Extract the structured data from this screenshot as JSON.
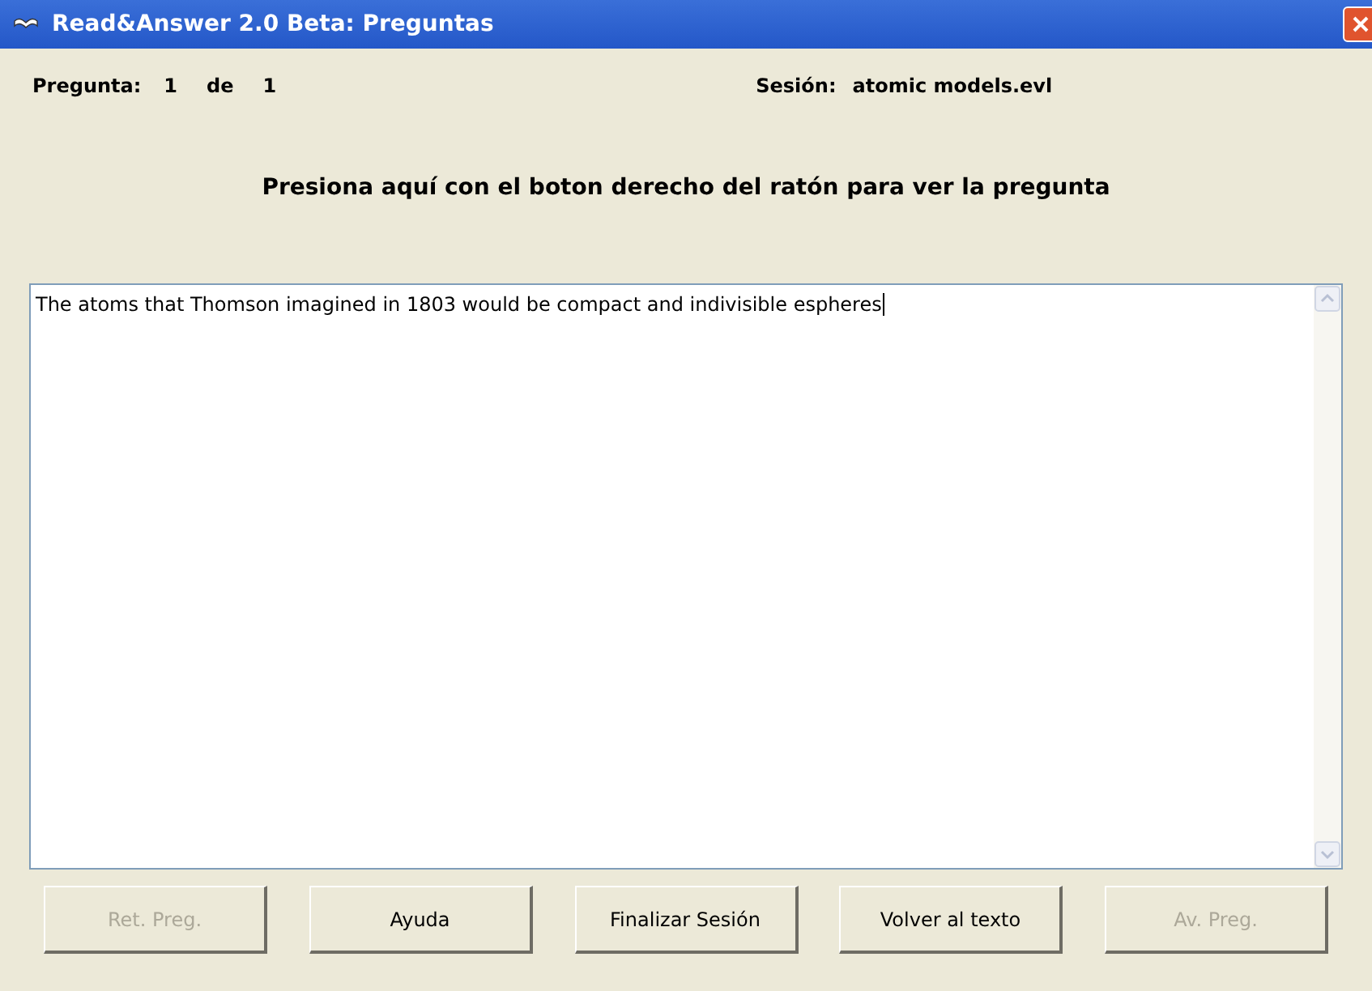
{
  "window": {
    "title": "Read&Answer 2.0 Beta: Preguntas"
  },
  "question_counter": {
    "label": "Pregunta:",
    "current": "1",
    "separator": "de",
    "total": "1"
  },
  "session": {
    "label": "Sesión:",
    "value": "atomic models.evl"
  },
  "instruction": "Presiona aquí con el boton derecho del ratón para ver la pregunta",
  "answer": {
    "value": "The atoms that Thomson imagined in 1803 would be compact and indivisible espheres"
  },
  "buttons": [
    {
      "label": "Ret. Preg.",
      "disabled": true
    },
    {
      "label": "Ayuda",
      "disabled": false
    },
    {
      "label": "Finalizar Sesión",
      "disabled": false
    },
    {
      "label": "Volver al texto",
      "disabled": false
    },
    {
      "label": "Av. Preg.",
      "disabled": true
    }
  ]
}
